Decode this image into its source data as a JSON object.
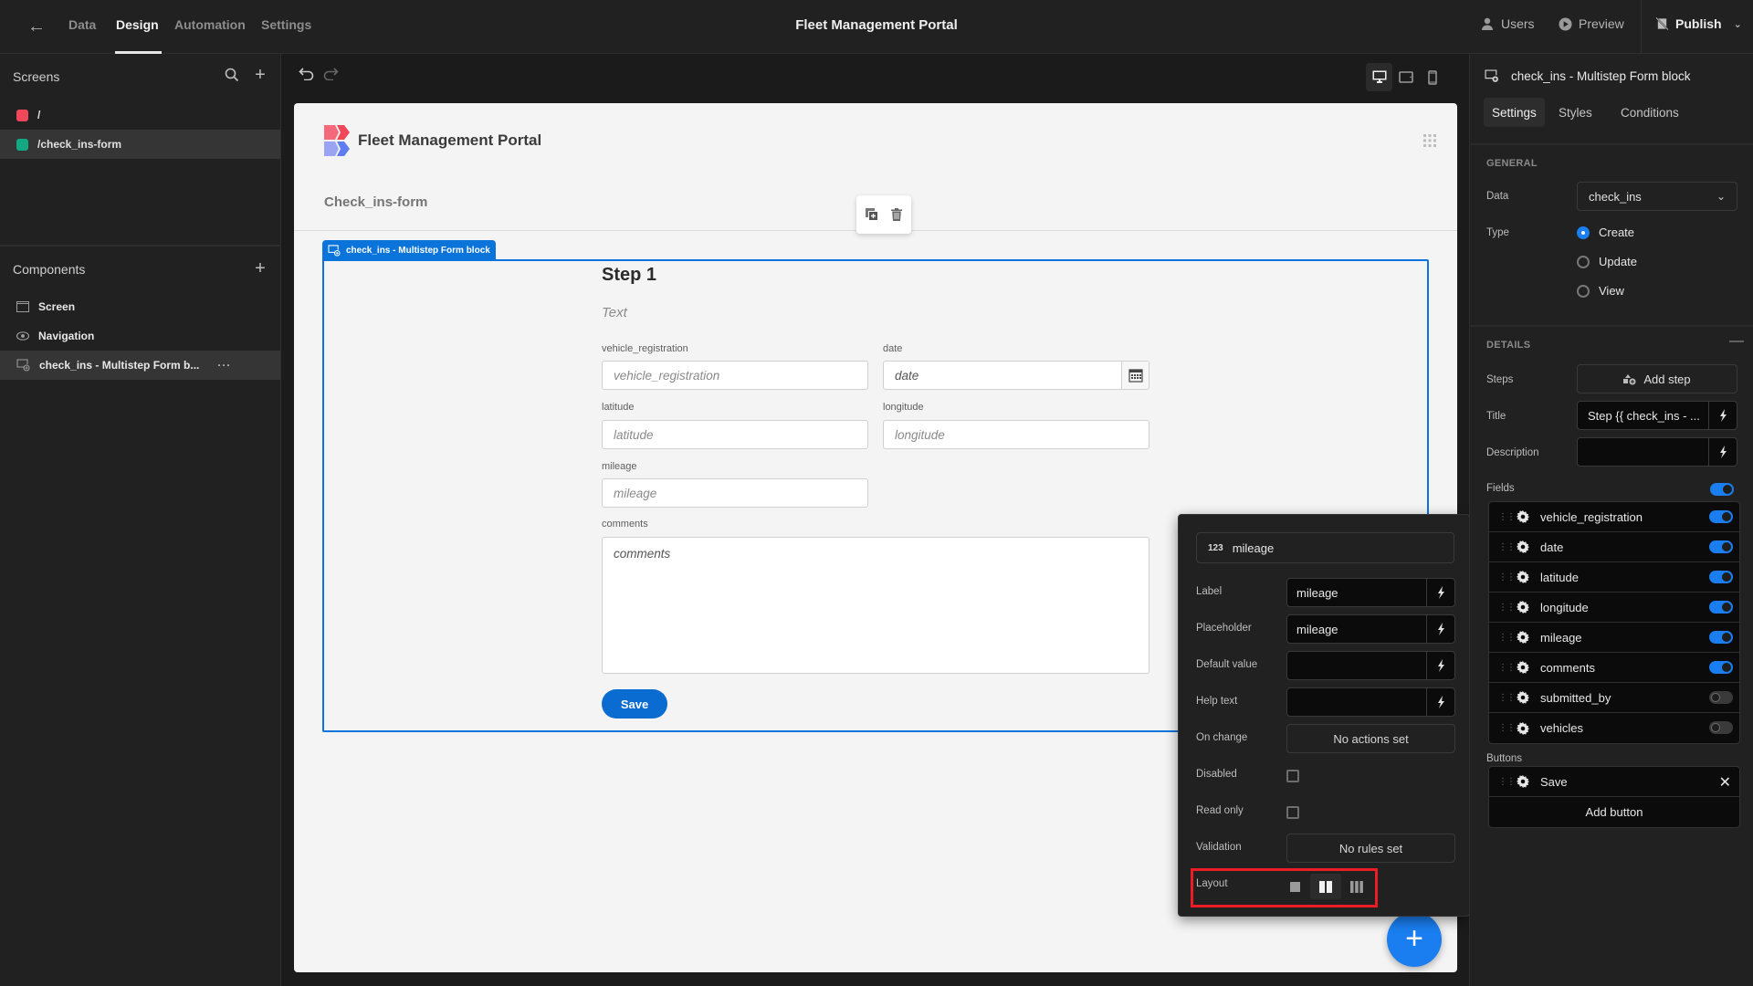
{
  "topbar": {
    "nav_tabs": [
      {
        "label": "Data",
        "active": false
      },
      {
        "label": "Design",
        "active": true
      },
      {
        "label": "Automation",
        "active": false
      },
      {
        "label": "Settings",
        "active": false
      }
    ],
    "app_title": "Fleet Management Portal",
    "users_label": "Users",
    "preview_label": "Preview",
    "publish_label": "Publish"
  },
  "sidebar": {
    "screens_title": "Screens",
    "screens": [
      {
        "label": "/",
        "color": "#f0475a",
        "selected": false
      },
      {
        "label": "/check_ins-form",
        "color": "#13a884",
        "selected": true
      }
    ],
    "components_title": "Components",
    "components": [
      {
        "label": "Screen",
        "icon": "screen-icon",
        "selected": false
      },
      {
        "label": "Navigation",
        "icon": "eye-icon",
        "selected": false
      },
      {
        "label": "check_ins - Multistep Form b...",
        "icon": "form-block-icon",
        "selected": true
      }
    ]
  },
  "canvas": {
    "app_title": "Fleet Management Portal",
    "screen_title": "Check_ins-form",
    "block_tag": "check_ins - Multistep Form block",
    "form": {
      "step_title": "Step 1",
      "step_description": "Text",
      "fields": {
        "vehicle_registration": {
          "label": "vehicle_registration",
          "placeholder": "vehicle_registration"
        },
        "date": {
          "label": "date",
          "placeholder": "date"
        },
        "latitude": {
          "label": "latitude",
          "placeholder": "latitude"
        },
        "longitude": {
          "label": "longitude",
          "placeholder": "longitude"
        },
        "mileage": {
          "label": "mileage",
          "placeholder": "mileage"
        },
        "comments": {
          "label": "comments",
          "placeholder": "comments"
        }
      },
      "save_label": "Save"
    },
    "fab_label": "+"
  },
  "popover": {
    "field_type_badge": "123",
    "field_name": "mileage",
    "rows": {
      "label": {
        "label": "Label",
        "value": "mileage"
      },
      "placeholder": {
        "label": "Placeholder",
        "value": "mileage"
      },
      "default_value": {
        "label": "Default value",
        "value": ""
      },
      "help_text": {
        "label": "Help text",
        "value": ""
      },
      "on_change": {
        "label": "On change",
        "value": "No actions set"
      },
      "disabled": {
        "label": "Disabled",
        "checked": false
      },
      "read_only": {
        "label": "Read only",
        "checked": false
      },
      "validation": {
        "label": "Validation",
        "value": "No rules set"
      },
      "layout": {
        "label": "Layout",
        "options": [
          "single-column",
          "two-column",
          "three-column"
        ],
        "selected": "two-column"
      }
    }
  },
  "right_panel": {
    "title": "check_ins - Multistep Form block",
    "tabs": [
      {
        "label": "Settings",
        "active": true
      },
      {
        "label": "Styles",
        "active": false
      },
      {
        "label": "Conditions",
        "active": false
      }
    ],
    "general": {
      "section_title": "GENERAL",
      "data_label": "Data",
      "data_value": "check_ins",
      "type_label": "Type",
      "type_options": [
        {
          "label": "Create",
          "selected": true
        },
        {
          "label": "Update",
          "selected": false
        },
        {
          "label": "View",
          "selected": false
        }
      ]
    },
    "details": {
      "section_title": "DETAILS",
      "steps_label": "Steps",
      "add_step_label": "Add step",
      "title_label": "Title",
      "title_value": "Step {{ check_ins - ...",
      "description_label": "Description",
      "description_value": "",
      "fields_label": "Fields",
      "fields_toggle": true,
      "fields": [
        {
          "name": "vehicle_registration",
          "enabled": true
        },
        {
          "name": "date",
          "enabled": true
        },
        {
          "name": "latitude",
          "enabled": true
        },
        {
          "name": "longitude",
          "enabled": true
        },
        {
          "name": "mileage",
          "enabled": true
        },
        {
          "name": "comments",
          "enabled": true
        },
        {
          "name": "submitted_by",
          "enabled": false
        },
        {
          "name": "vehicles",
          "enabled": false
        }
      ],
      "buttons_label": "Buttons",
      "buttons": [
        {
          "name": "Save"
        }
      ],
      "add_button_label": "Add button"
    }
  },
  "colors": {
    "accent": "#1a7ef0",
    "selection_border": "#0a74da",
    "highlight_box": "#ee1c25"
  }
}
